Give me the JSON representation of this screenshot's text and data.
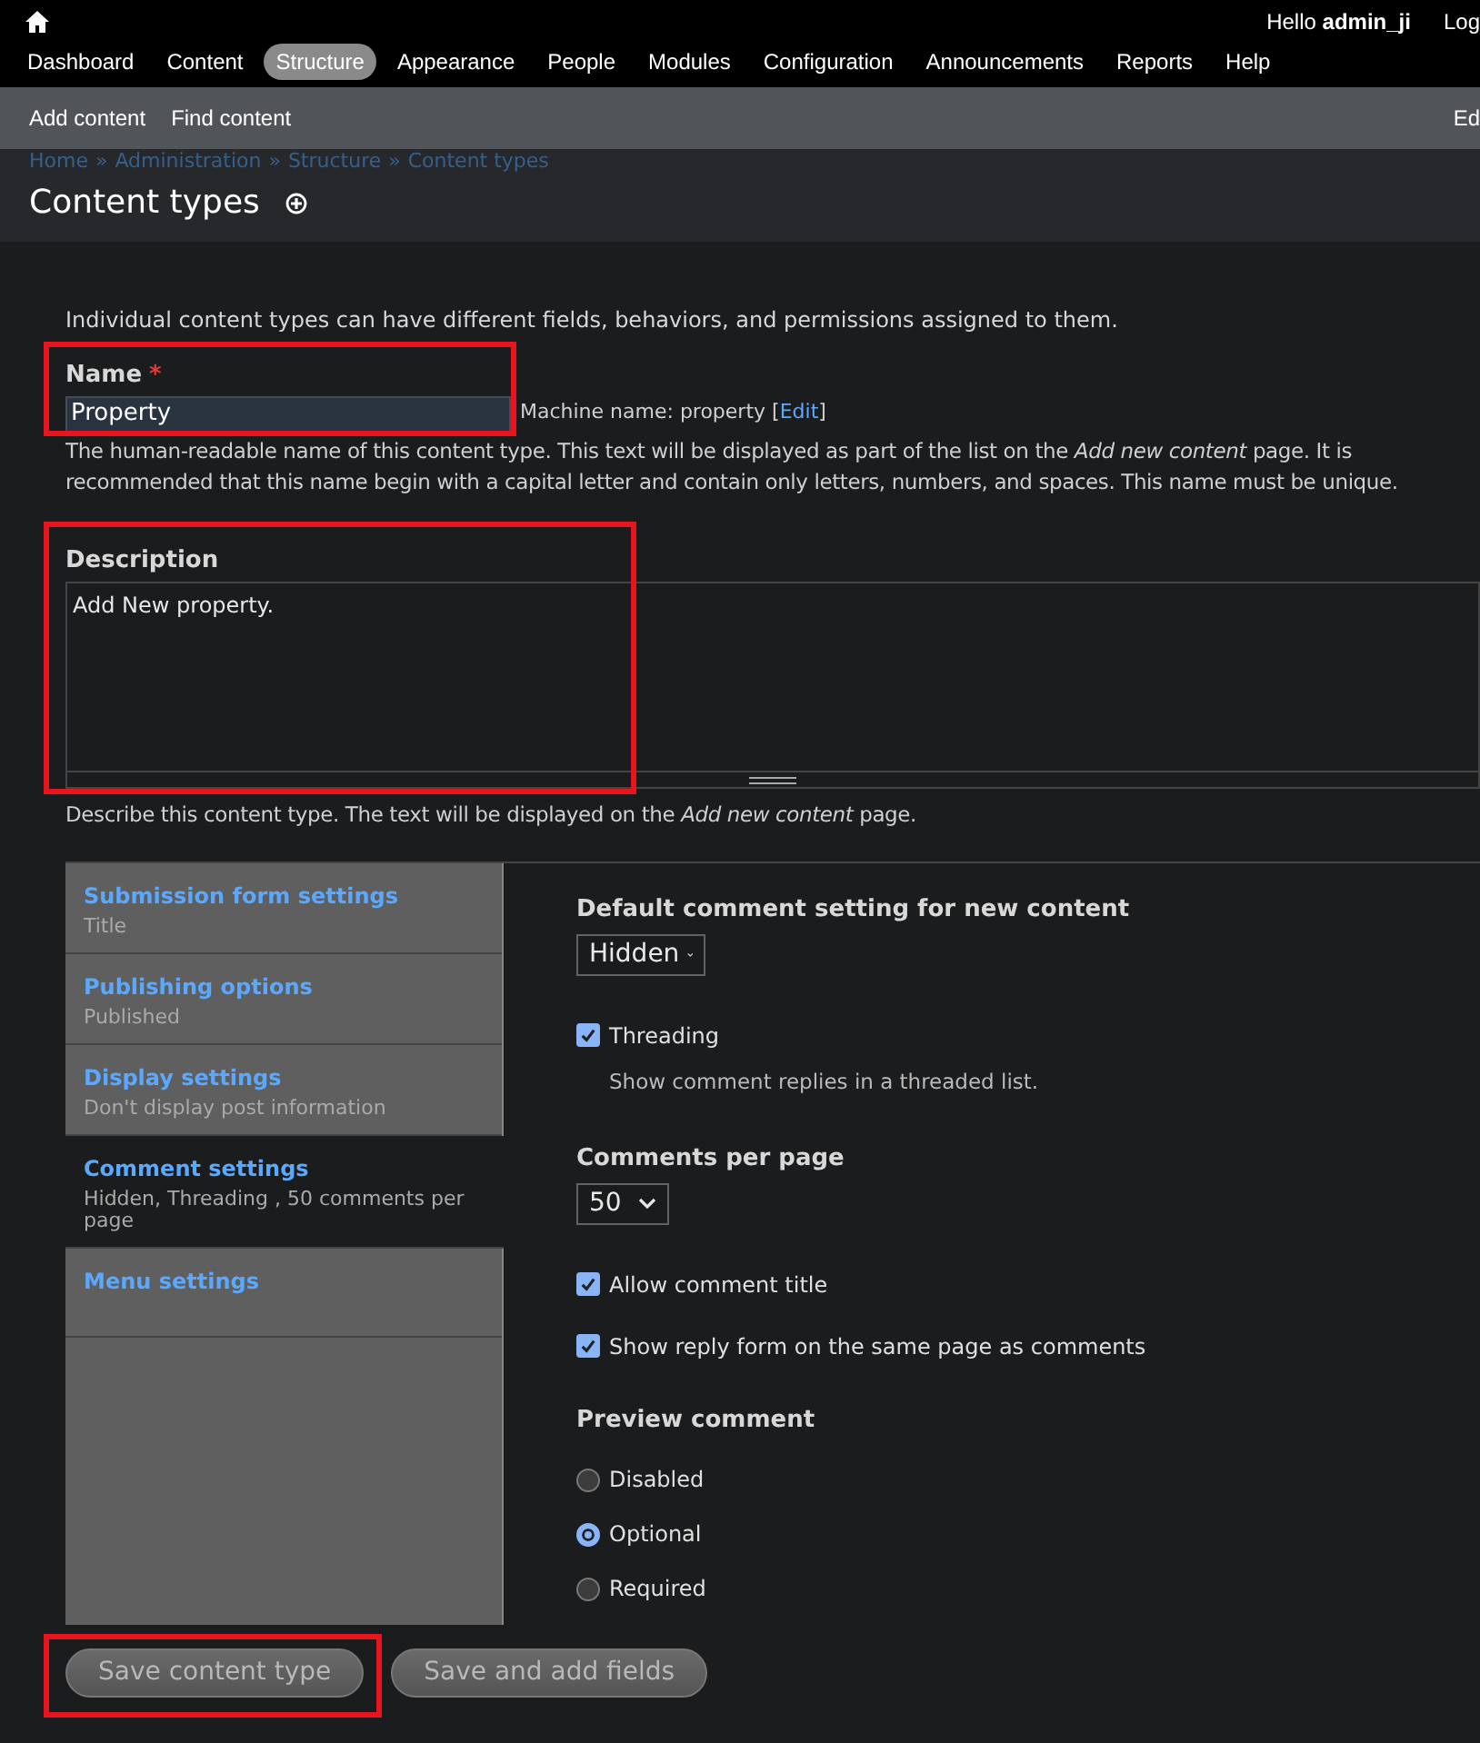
{
  "topbar": {
    "greeting": "Hello",
    "user": "admin_ji",
    "logout": "Log"
  },
  "menu": [
    {
      "label": "Dashboard",
      "selected": false
    },
    {
      "label": "Content",
      "selected": false
    },
    {
      "label": "Structure",
      "selected": true
    },
    {
      "label": "Appearance",
      "selected": false
    },
    {
      "label": "People",
      "selected": false
    },
    {
      "label": "Modules",
      "selected": false
    },
    {
      "label": "Configuration",
      "selected": false
    },
    {
      "label": "Announcements",
      "selected": false
    },
    {
      "label": "Reports",
      "selected": false
    },
    {
      "label": "Help",
      "selected": false
    }
  ],
  "shortcuts": [
    "Add content",
    "Find content"
  ],
  "shortcuts_edit": "Ed",
  "breadcrumb": [
    "Home",
    "Administration",
    "Structure",
    "Content types"
  ],
  "breadcrumb_separator": "»",
  "page_title": "Content types",
  "intro": "Individual content types can have different fields, behaviors, and permissions assigned to them.",
  "name_field": {
    "label": "Name",
    "required_mark": "*",
    "value": "Property",
    "machine_label": "Machine name: property",
    "machine_edit": "Edit",
    "machine_edit_open": "[",
    "machine_edit_close": "]",
    "help": "The human-readable name of this content type. This text will be displayed as part of the list on the *Add new content* page. It is recommended that this name begin with a capital letter and contain only letters, numbers, and spaces. This name must be unique."
  },
  "description_field": {
    "label": "Description",
    "value": "Add New property.",
    "help": "Describe this content type. The text will be displayed on the *Add new content* page."
  },
  "vertical_tabs": [
    {
      "title": "Submission form settings",
      "summary": "Title",
      "selected": false
    },
    {
      "title": "Publishing options",
      "summary": "Published",
      "selected": false
    },
    {
      "title": "Display settings",
      "summary": "Don't display post information",
      "selected": false
    },
    {
      "title": "Comment settings",
      "summary": "Hidden, Threading , 50 comments per page",
      "selected": true
    },
    {
      "title": "Menu settings",
      "selected": false
    }
  ],
  "comment_settings": [
    {
      "kind": "select",
      "label": "Default comment setting for new content",
      "value": "Hidden"
    },
    {
      "kind": "checkbox",
      "label": "Threading",
      "checked": true,
      "help": "Show comment replies in a threaded list."
    },
    {
      "kind": "select",
      "label": "Comments per page",
      "value": "50"
    },
    {
      "kind": "checkbox",
      "label": "Allow comment title",
      "checked": true
    },
    {
      "kind": "checkbox",
      "label": "Show reply form on the same page as comments",
      "checked": true
    },
    {
      "kind": "radios",
      "label": "Preview comment",
      "options": [
        {
          "label": "Disabled",
          "selected": false
        },
        {
          "label": "Optional",
          "selected": true
        },
        {
          "label": "Required",
          "selected": false
        }
      ]
    }
  ],
  "actions": [
    "Save content type",
    "Save and add fields"
  ]
}
